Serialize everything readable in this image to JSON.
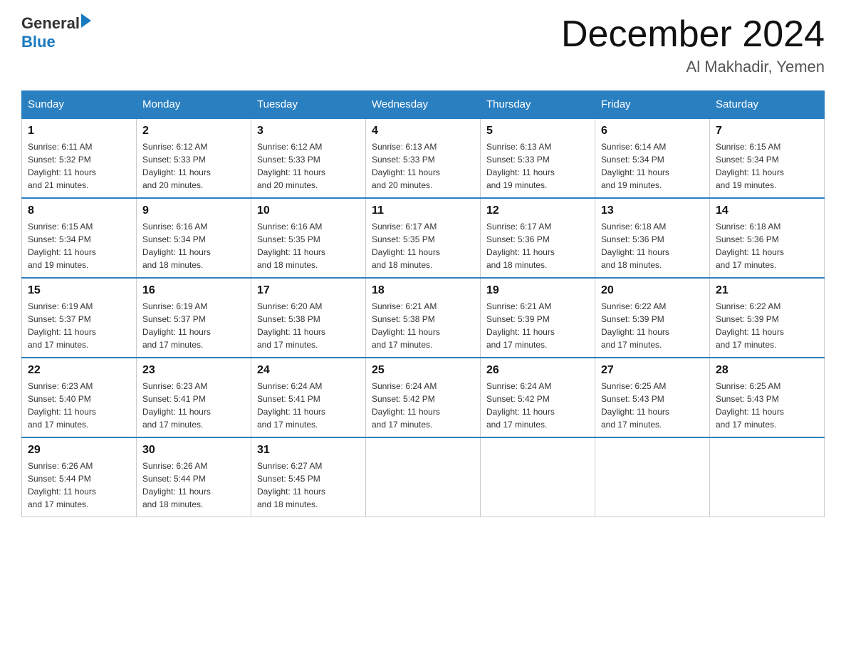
{
  "header": {
    "logo_general": "General",
    "logo_blue": "Blue",
    "month_title": "December 2024",
    "location": "Al Makhadir, Yemen"
  },
  "weekdays": [
    "Sunday",
    "Monday",
    "Tuesday",
    "Wednesday",
    "Thursday",
    "Friday",
    "Saturday"
  ],
  "weeks": [
    [
      {
        "day": "1",
        "info": "Sunrise: 6:11 AM\nSunset: 5:32 PM\nDaylight: 11 hours\nand 21 minutes."
      },
      {
        "day": "2",
        "info": "Sunrise: 6:12 AM\nSunset: 5:33 PM\nDaylight: 11 hours\nand 20 minutes."
      },
      {
        "day": "3",
        "info": "Sunrise: 6:12 AM\nSunset: 5:33 PM\nDaylight: 11 hours\nand 20 minutes."
      },
      {
        "day": "4",
        "info": "Sunrise: 6:13 AM\nSunset: 5:33 PM\nDaylight: 11 hours\nand 20 minutes."
      },
      {
        "day": "5",
        "info": "Sunrise: 6:13 AM\nSunset: 5:33 PM\nDaylight: 11 hours\nand 19 minutes."
      },
      {
        "day": "6",
        "info": "Sunrise: 6:14 AM\nSunset: 5:34 PM\nDaylight: 11 hours\nand 19 minutes."
      },
      {
        "day": "7",
        "info": "Sunrise: 6:15 AM\nSunset: 5:34 PM\nDaylight: 11 hours\nand 19 minutes."
      }
    ],
    [
      {
        "day": "8",
        "info": "Sunrise: 6:15 AM\nSunset: 5:34 PM\nDaylight: 11 hours\nand 19 minutes."
      },
      {
        "day": "9",
        "info": "Sunrise: 6:16 AM\nSunset: 5:34 PM\nDaylight: 11 hours\nand 18 minutes."
      },
      {
        "day": "10",
        "info": "Sunrise: 6:16 AM\nSunset: 5:35 PM\nDaylight: 11 hours\nand 18 minutes."
      },
      {
        "day": "11",
        "info": "Sunrise: 6:17 AM\nSunset: 5:35 PM\nDaylight: 11 hours\nand 18 minutes."
      },
      {
        "day": "12",
        "info": "Sunrise: 6:17 AM\nSunset: 5:36 PM\nDaylight: 11 hours\nand 18 minutes."
      },
      {
        "day": "13",
        "info": "Sunrise: 6:18 AM\nSunset: 5:36 PM\nDaylight: 11 hours\nand 18 minutes."
      },
      {
        "day": "14",
        "info": "Sunrise: 6:18 AM\nSunset: 5:36 PM\nDaylight: 11 hours\nand 17 minutes."
      }
    ],
    [
      {
        "day": "15",
        "info": "Sunrise: 6:19 AM\nSunset: 5:37 PM\nDaylight: 11 hours\nand 17 minutes."
      },
      {
        "day": "16",
        "info": "Sunrise: 6:19 AM\nSunset: 5:37 PM\nDaylight: 11 hours\nand 17 minutes."
      },
      {
        "day": "17",
        "info": "Sunrise: 6:20 AM\nSunset: 5:38 PM\nDaylight: 11 hours\nand 17 minutes."
      },
      {
        "day": "18",
        "info": "Sunrise: 6:21 AM\nSunset: 5:38 PM\nDaylight: 11 hours\nand 17 minutes."
      },
      {
        "day": "19",
        "info": "Sunrise: 6:21 AM\nSunset: 5:39 PM\nDaylight: 11 hours\nand 17 minutes."
      },
      {
        "day": "20",
        "info": "Sunrise: 6:22 AM\nSunset: 5:39 PM\nDaylight: 11 hours\nand 17 minutes."
      },
      {
        "day": "21",
        "info": "Sunrise: 6:22 AM\nSunset: 5:39 PM\nDaylight: 11 hours\nand 17 minutes."
      }
    ],
    [
      {
        "day": "22",
        "info": "Sunrise: 6:23 AM\nSunset: 5:40 PM\nDaylight: 11 hours\nand 17 minutes."
      },
      {
        "day": "23",
        "info": "Sunrise: 6:23 AM\nSunset: 5:41 PM\nDaylight: 11 hours\nand 17 minutes."
      },
      {
        "day": "24",
        "info": "Sunrise: 6:24 AM\nSunset: 5:41 PM\nDaylight: 11 hours\nand 17 minutes."
      },
      {
        "day": "25",
        "info": "Sunrise: 6:24 AM\nSunset: 5:42 PM\nDaylight: 11 hours\nand 17 minutes."
      },
      {
        "day": "26",
        "info": "Sunrise: 6:24 AM\nSunset: 5:42 PM\nDaylight: 11 hours\nand 17 minutes."
      },
      {
        "day": "27",
        "info": "Sunrise: 6:25 AM\nSunset: 5:43 PM\nDaylight: 11 hours\nand 17 minutes."
      },
      {
        "day": "28",
        "info": "Sunrise: 6:25 AM\nSunset: 5:43 PM\nDaylight: 11 hours\nand 17 minutes."
      }
    ],
    [
      {
        "day": "29",
        "info": "Sunrise: 6:26 AM\nSunset: 5:44 PM\nDaylight: 11 hours\nand 17 minutes."
      },
      {
        "day": "30",
        "info": "Sunrise: 6:26 AM\nSunset: 5:44 PM\nDaylight: 11 hours\nand 18 minutes."
      },
      {
        "day": "31",
        "info": "Sunrise: 6:27 AM\nSunset: 5:45 PM\nDaylight: 11 hours\nand 18 minutes."
      },
      {
        "day": "",
        "info": ""
      },
      {
        "day": "",
        "info": ""
      },
      {
        "day": "",
        "info": ""
      },
      {
        "day": "",
        "info": ""
      }
    ]
  ]
}
